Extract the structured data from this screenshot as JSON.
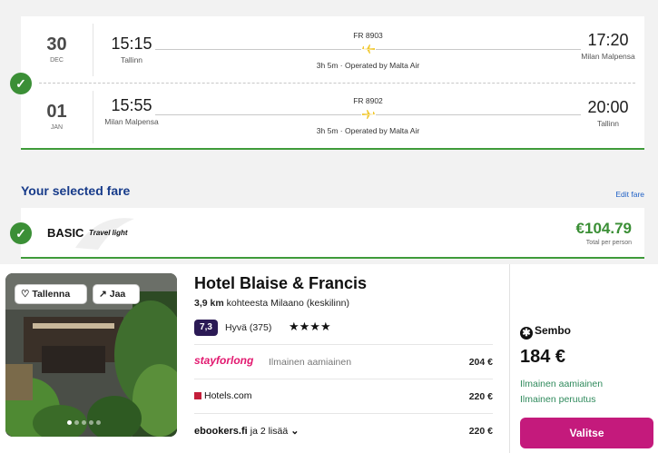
{
  "flights": [
    {
      "day": "30",
      "month": "DEC",
      "dep_time": "15:15",
      "dep_city": "Tallinn",
      "flight_no": "FR 8903",
      "duration": "3h 5m · Operated by Malta Air",
      "arr_time": "17:20",
      "arr_city": "Milan Malpensa"
    },
    {
      "day": "01",
      "month": "JAN",
      "dep_time": "15:55",
      "dep_city": "Milan Malpensa",
      "flight_no": "FR 8902",
      "duration": "3h 5m · Operated by Malta Air",
      "arr_time": "20:00",
      "arr_city": "Tallinn"
    }
  ],
  "fare": {
    "section_title": "Your selected fare",
    "edit_label": "Edit fare",
    "name": "BASIC",
    "subtitle": "Travel light",
    "price": "€104.79",
    "price_note": "Total per person"
  },
  "hotel": {
    "save_label": "Tallenna",
    "share_label": "Jaa",
    "name": "Hotel Blaise & Francis",
    "distance_value": "3,9 km",
    "distance_text": "kohteesta Milaano (keskilinn)",
    "rating": "7,3",
    "rating_text": "Hyvä (375)",
    "stars": "★★★★",
    "offers": [
      {
        "provider": "stayforlong",
        "perk": "Ilmainen aamiainen",
        "price": "204 €"
      },
      {
        "provider": "Hotels.com",
        "perk": "",
        "price": "220 €"
      },
      {
        "provider": "ebookers.fi",
        "more": "ja 2 lisää",
        "perk": "",
        "price": "220 €"
      }
    ],
    "best": {
      "provider": "Sembo",
      "price": "184 €",
      "perk1": "Ilmainen aamiainen",
      "perk2": "Ilmainen peruutus",
      "select_label": "Valitse"
    }
  },
  "colors": {
    "accent_green": "#3b8f36",
    "title_blue": "#173b8a",
    "cta_magenta": "#c41a7c",
    "rating_bg": "#2b1a55"
  }
}
